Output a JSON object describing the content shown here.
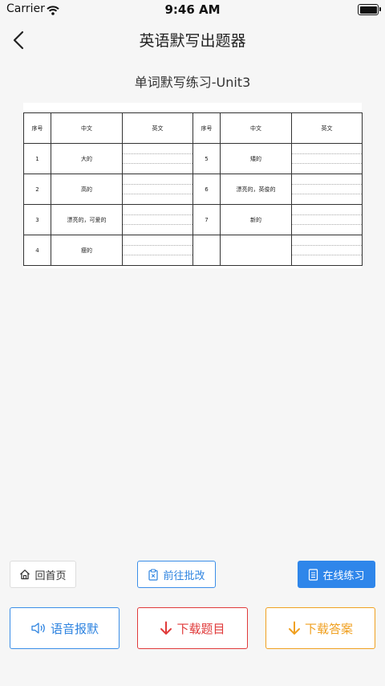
{
  "status": {
    "carrier": "Carrier",
    "time": "9:46 AM"
  },
  "nav": {
    "title": "英语默写出题器"
  },
  "doc": {
    "title": "单词默写练习-Unit3"
  },
  "table": {
    "headers": [
      "序号",
      "中文",
      "英文",
      "序号",
      "中文",
      "英文"
    ],
    "rows": [
      {
        "n1": "1",
        "c1": "大的",
        "n2": "5",
        "c2": "矮的"
      },
      {
        "n1": "2",
        "c1": "高的",
        "n2": "6",
        "c2": "漂亮的，英俊的"
      },
      {
        "n1": "3",
        "c1": "漂亮的，可爱的",
        "n2": "7",
        "c2": "新的"
      },
      {
        "n1": "4",
        "c1": "瘦的",
        "n2": "",
        "c2": ""
      }
    ]
  },
  "buttons": {
    "home": "回首页",
    "correct": "前往批改",
    "practice": "在线练习",
    "voice": "语音报默",
    "download_questions": "下载题目",
    "download_answers": "下载答案"
  },
  "colors": {
    "blue": "#2f86ea",
    "red": "#e03a3a",
    "orange": "#f0a020"
  }
}
